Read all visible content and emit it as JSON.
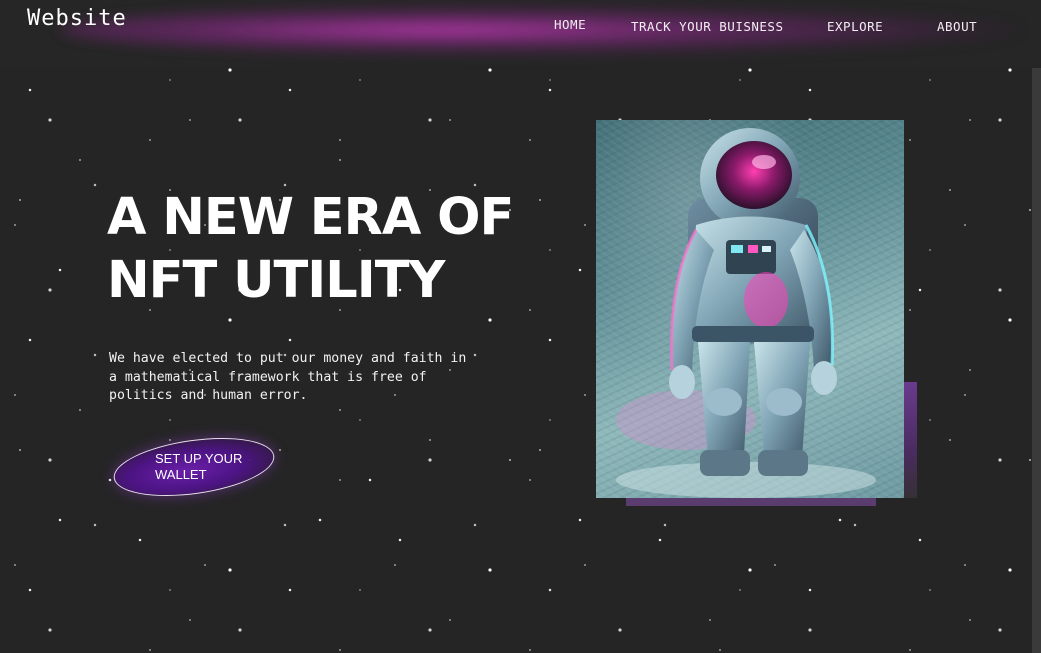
{
  "header": {
    "logo": "Website",
    "nav": [
      {
        "label": "HOME"
      },
      {
        "label": "TRACK YOUR BUISNESS"
      },
      {
        "label": "EXPLORE"
      },
      {
        "label": "ABOUT"
      }
    ]
  },
  "hero": {
    "title": "A NEW ERA OF NFT UTILITY",
    "description": "We have elected to put our money and faith in a mathematical framework that is free of politics and human error.",
    "cta_label": "SET UP YOUR WALLET",
    "image_icon": "astronaut-artwork"
  },
  "colors": {
    "background": "#252525",
    "accent_glow": "#d63cc8",
    "button_fill": "#5a1a96",
    "frame_accent": "#6a3a8e"
  }
}
